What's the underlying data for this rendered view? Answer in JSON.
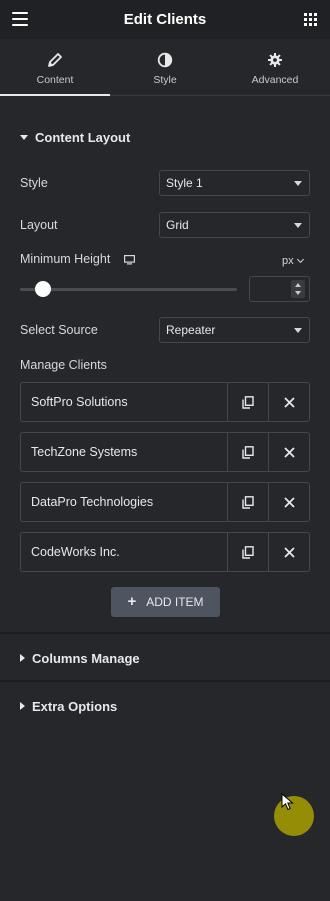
{
  "topbar": {
    "title": "Edit Clients",
    "menu_icon": "hamburger-icon",
    "apps_icon": "grid-icon"
  },
  "tabs": [
    {
      "label": "Content",
      "icon": "pencil-icon",
      "active": true
    },
    {
      "label": "Style",
      "icon": "contrast-icon",
      "active": false
    },
    {
      "label": "Advanced",
      "icon": "gear-icon",
      "active": false
    }
  ],
  "content_layout": {
    "heading": "Content Layout",
    "style": {
      "label": "Style",
      "value": "Style 1"
    },
    "layout": {
      "label": "Layout",
      "value": "Grid"
    },
    "min_height": {
      "label": "Minimum Height",
      "unit": "px",
      "device_icon": "monitor-icon"
    },
    "select_source": {
      "label": "Select Source",
      "value": "Repeater"
    },
    "manage_clients": {
      "label": "Manage Clients",
      "items": [
        {
          "name": "SoftPro Solutions"
        },
        {
          "name": "TechZone Systems"
        },
        {
          "name": "DataPro Technologies"
        },
        {
          "name": "CodeWorks Inc."
        }
      ],
      "add_label": "ADD ITEM"
    }
  },
  "columns_manage": {
    "heading": "Columns Manage"
  },
  "extra_options": {
    "heading": "Extra Options"
  },
  "colors": {
    "background": "#26272b",
    "topbar": "#1f2124",
    "add_button": "#4f5560",
    "cursor_halo": "#aaa000"
  }
}
